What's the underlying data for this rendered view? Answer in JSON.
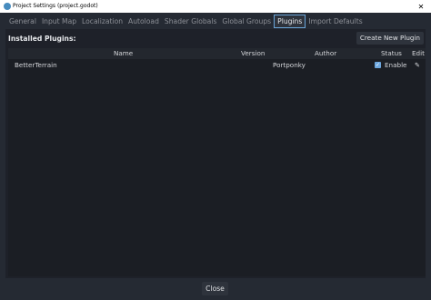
{
  "window": {
    "title": "Project Settings (project.godot)"
  },
  "tabs": [
    {
      "label": "General"
    },
    {
      "label": "Input Map"
    },
    {
      "label": "Localization"
    },
    {
      "label": "Autoload"
    },
    {
      "label": "Shader Globals"
    },
    {
      "label": "Global Groups"
    },
    {
      "label": "Plugins",
      "active": true
    },
    {
      "label": "Import Defaults"
    }
  ],
  "plugins": {
    "heading": "Installed Plugins:",
    "create_button": "Create New Plugin",
    "columns": {
      "name": "Name",
      "version": "Version",
      "author": "Author",
      "status": "Status",
      "edit": "Edit"
    },
    "rows": [
      {
        "name": "BetterTerrain",
        "version": "",
        "author": "Portponky",
        "enabled": true,
        "status_label": "Enable"
      }
    ]
  },
  "footer": {
    "close_button": "Close"
  },
  "colors": {
    "accent": "#478cbf",
    "active_tab_border": "#6aa5d8",
    "checkbox": "#6ea8e0"
  }
}
